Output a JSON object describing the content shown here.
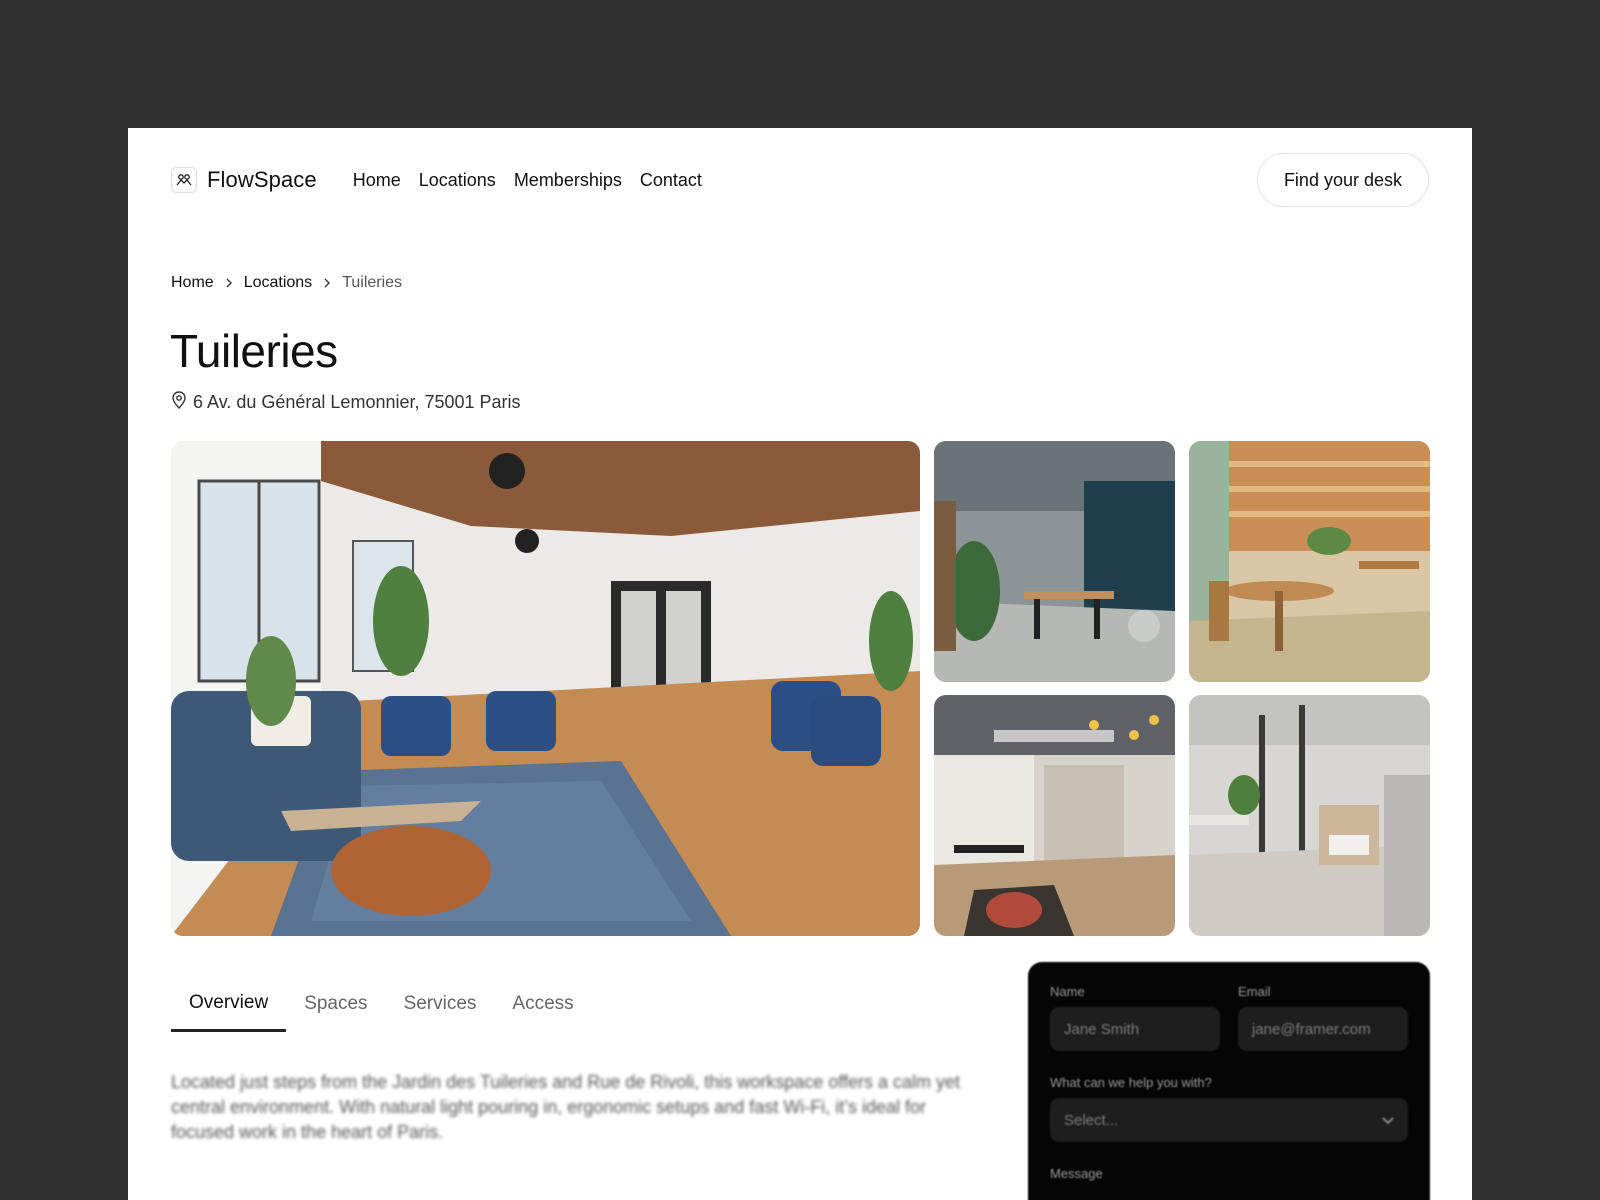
{
  "brand": {
    "name": "FlowSpace"
  },
  "nav": {
    "links": [
      "Home",
      "Locations",
      "Memberships",
      "Contact"
    ],
    "cta": "Find your desk"
  },
  "breadcrumb": [
    "Home",
    "Locations",
    "Tuileries"
  ],
  "location": {
    "title": "Tuileries",
    "address": "6 Av. du Général Lemonnier, 75001 Paris"
  },
  "tabs": [
    "Overview",
    "Spaces",
    "Services",
    "Access"
  ],
  "overview_text": "Located just steps from the Jardin des Tuileries and Rue de Rivoli, this workspace offers a calm yet central environment. With natural light pouring in, ergonomic setups and fast Wi-Fi, it’s ideal for focused work in the heart of Paris.",
  "form": {
    "name_label": "Name",
    "name_placeholder": "Jane Smith",
    "email_label": "Email",
    "email_placeholder": "jane@framer.com",
    "help_label": "What can we help you with?",
    "help_placeholder": "Select...",
    "message_label": "Message"
  },
  "colors": {
    "background": "#2f2f2f",
    "panel": "#050505",
    "accent": "#111111"
  }
}
